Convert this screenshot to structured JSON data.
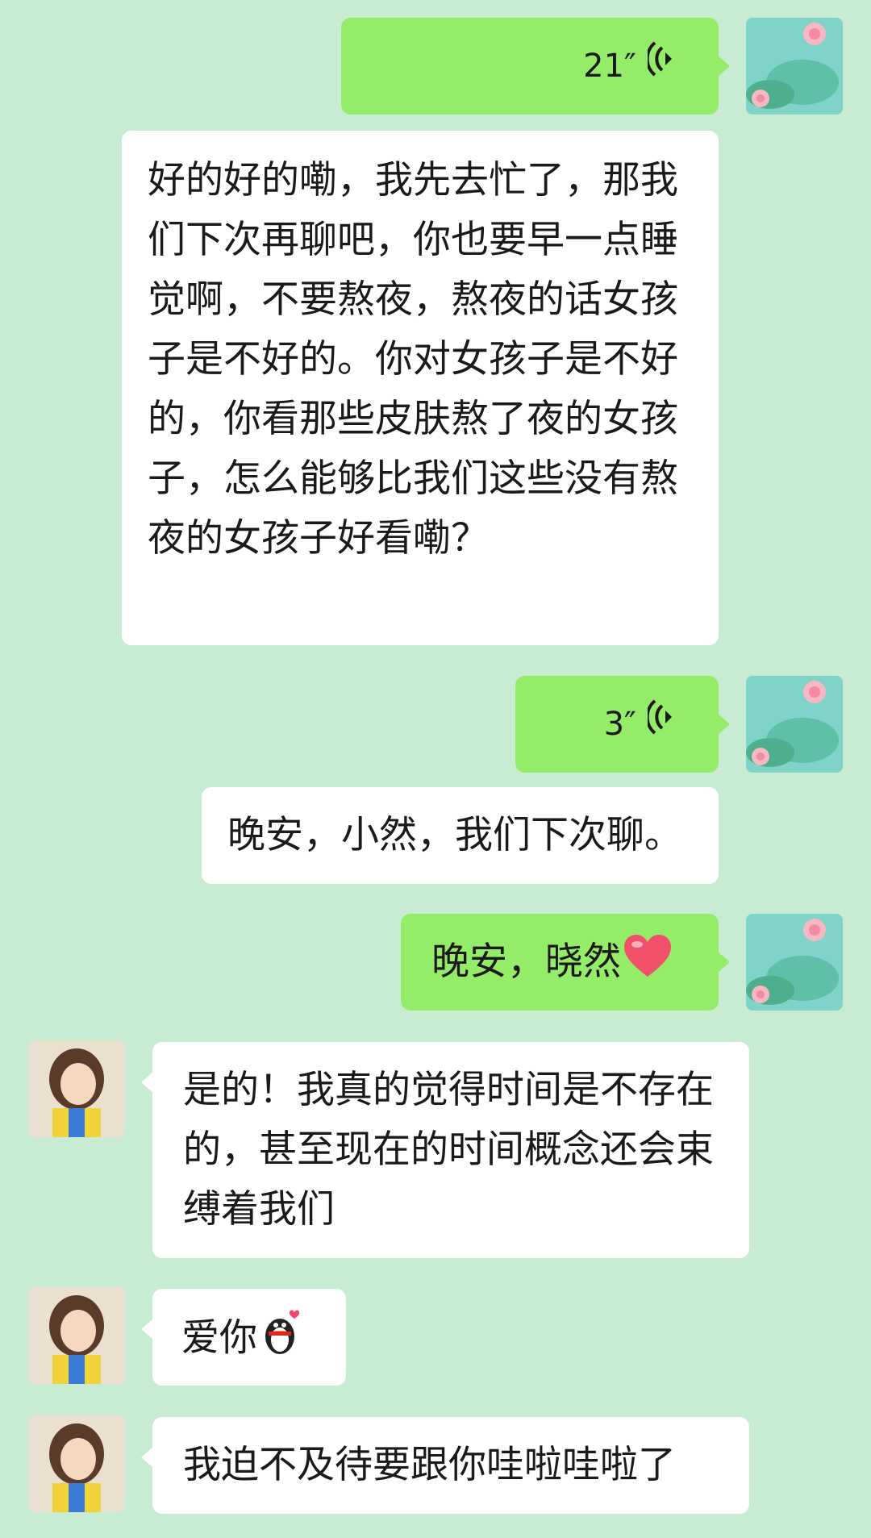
{
  "messages": [
    {
      "side": "right",
      "type": "voice",
      "duration": "21″"
    },
    {
      "side": "right",
      "type": "text",
      "text": "好的好的嘞，我先去忙了，那我们下次再聊吧，你也要早一点睡觉啊，不要熬夜，熬夜的话女孩子是不好的。你对女孩子是不好的，你看那些皮肤熬了夜的女孩子，怎么能够比我们这些没有熬夜的女孩子好看嘞？"
    },
    {
      "side": "right",
      "type": "voice",
      "duration": "3″"
    },
    {
      "side": "right",
      "type": "text",
      "text": "晚安，小然，我们下次聊。"
    },
    {
      "side": "right",
      "type": "text",
      "text": "晚安，晓然",
      "emoji": "heart-emoji"
    },
    {
      "side": "left",
      "type": "text",
      "text": "是的！我真的觉得时间是不存在的，甚至现在的时间概念还会束缚着我们"
    },
    {
      "side": "left",
      "type": "text",
      "text": "爱你",
      "emoji": "qq-penguin-emoji"
    },
    {
      "side": "left",
      "type": "text",
      "text": "我迫不及待要跟你哇啦哇啦了"
    }
  ],
  "colors": {
    "background": "#c8ecd2",
    "sent_bubble": "#95ec69",
    "received_bubble": "#ffffff"
  },
  "icons": [
    "voice-wave-icon",
    "lotus-avatar",
    "girl-avatar",
    "heart-emoji",
    "qq-penguin-emoji"
  ]
}
